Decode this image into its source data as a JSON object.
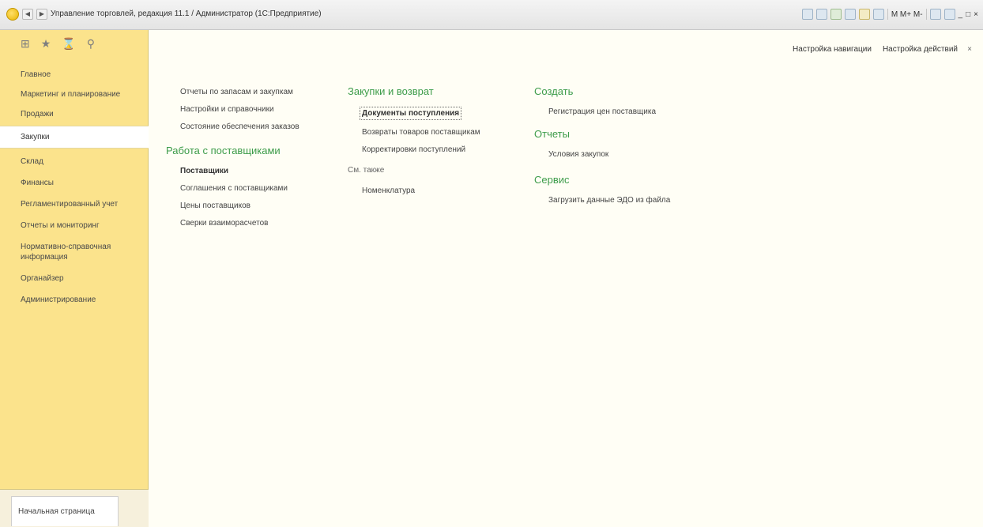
{
  "window": {
    "title": "Управление торговлей, редакция 11.1 / Администратор (1С:Предприятие)",
    "right_text": "M  M+  M-",
    "min_btn": "_",
    "max_btn": "□",
    "close_btn": "×"
  },
  "sidebar": {
    "tools": [
      "grid-icon",
      "star-icon",
      "history-icon",
      "search-icon"
    ],
    "items": [
      {
        "label": "Главное"
      },
      {
        "label": "Маркетинг и планирование"
      },
      {
        "label": "Продажи"
      },
      {
        "label": "Закупки"
      },
      {
        "label": "Склад"
      },
      {
        "label": "Финансы"
      },
      {
        "label": "Регламентированный учет"
      },
      {
        "label": "Отчеты и мониторинг"
      },
      {
        "label": "Нормативно-справочная информация"
      },
      {
        "label": "Органайзер"
      },
      {
        "label": "Администрирование"
      }
    ],
    "active_index": 3,
    "home_tab": "Начальная страница"
  },
  "header": {
    "nav_settings": "Настройка навигации",
    "action_settings": "Настройка действий",
    "close": "×"
  },
  "col1": {
    "links": [
      "Отчеты по запасам и закупкам",
      "Настройки и справочники",
      "Состояние обеспечения заказов"
    ],
    "section": "Работа с поставщиками",
    "section_links": [
      "Поставщики",
      "Соглашения с поставщиками",
      "Цены поставщиков",
      "Сверки взаиморасчетов"
    ]
  },
  "col2": {
    "section": "Закупки и возврат",
    "links": [
      "Документы поступления",
      "Возвраты товаров поставщикам",
      "Корректировки поступлений"
    ],
    "see_also": "См. также",
    "see_also_links": [
      "Номенклатура"
    ]
  },
  "col3": {
    "create_title": "Создать",
    "create_links": [
      "Регистрация цен поставщика"
    ],
    "reports_title": "Отчеты",
    "reports_links": [
      "Условия закупок"
    ],
    "service_title": "Сервис",
    "service_links": [
      "Загрузить данные ЭДО из файла"
    ]
  }
}
